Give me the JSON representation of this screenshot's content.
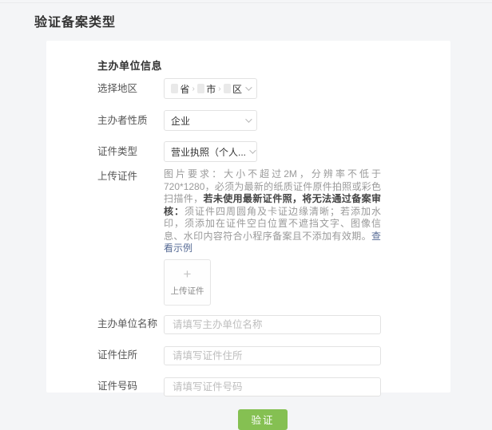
{
  "page": {
    "title": "验证备案类型"
  },
  "form": {
    "section_title": "主办单位信息",
    "region": {
      "label": "选择地区",
      "province_suffix": "省",
      "city_suffix": "市",
      "district_suffix": "区",
      "separator": "›"
    },
    "nature": {
      "label": "主办者性质",
      "value": "企业"
    },
    "cert_type": {
      "label": "证件类型",
      "value": "营业执照（个人..."
    },
    "upload": {
      "label": "上传证件",
      "requirements_prefix": "图片要求：大小不超过2M，分辨率不低于720*1280，必须为最新的纸质证件原件拍照或彩色扫描件，",
      "requirements_bold": "若未使用最新证件照，将无法通过备案审核：",
      "requirements_suffix": "须证件四周圆角及卡证边缘清晰；若添加水印，须添加在证件空白位置不遮挡文字、图像信息、水印内容符合小程序备案且不添加有效期。",
      "example_link": "查看示例",
      "plus": "+",
      "box_label": "上传证件"
    },
    "org_name": {
      "label": "主办单位名称",
      "placeholder": "请填写主办单位名称"
    },
    "cert_address": {
      "label": "证件住所",
      "placeholder": "请填写证件住所"
    },
    "cert_number": {
      "label": "证件号码",
      "placeholder": "请填写证件号码"
    },
    "verify_button": "验证"
  },
  "colors": {
    "accent_green": "#85c052",
    "link_blue": "#576b95",
    "page_bg": "#f4f5f7"
  }
}
